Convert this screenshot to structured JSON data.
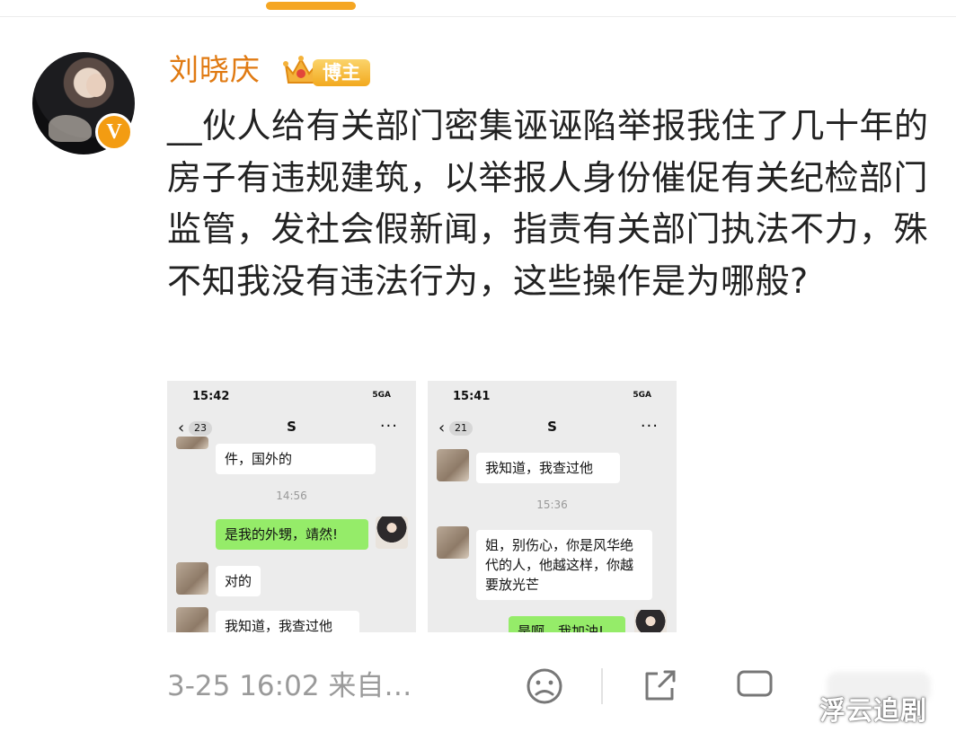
{
  "post": {
    "username": "刘晓庆",
    "badge_label": "博主",
    "verified_mark": "V",
    "text": "__伙人给有关部门密集诬诬陷举报我住了几十年的房子有违规建筑，以举报人身份催促有关纪检部门监管，发社会假新闻，指责有关部门执法不力，殊不知我没有违法行为，这些操作是为哪般?",
    "meta": "3-25 16:02 来自…"
  },
  "screenshots": [
    {
      "time": "15:42",
      "signal": "5GA",
      "back_count": "23",
      "chat_name": "S",
      "more": "···",
      "messages": {
        "m1": "件，国外的",
        "ts": "14:56",
        "m2": "是我的外甥，靖然!",
        "m3": "对的",
        "m4": "我知道，我查过他"
      }
    },
    {
      "time": "15:41",
      "signal": "5GA",
      "back_count": "21",
      "chat_name": "S",
      "more": "···",
      "messages": {
        "m1": "我知道，我查过他",
        "ts": "15:36",
        "m2": "姐，别伤心，你是风华绝代的人，他越这样，你越要放光芒",
        "m3": "是啊，我加油!"
      }
    }
  ],
  "footer_icons": [
    "sad-face-icon",
    "share-icon",
    "comment-icon",
    "like-icon"
  ],
  "watermark": "浮云追剧",
  "colors": {
    "username": "#e07a12",
    "accent": "#f5a623",
    "wechat_green": "#95ec69"
  }
}
